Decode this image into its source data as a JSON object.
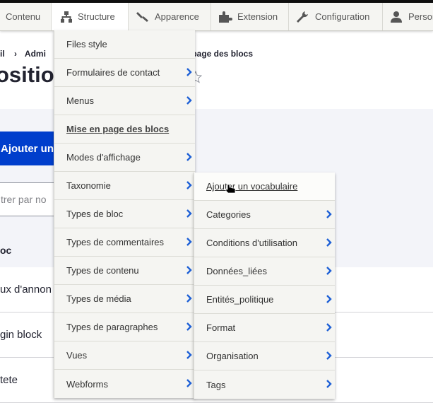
{
  "toolbar": {
    "items": [
      {
        "label": "Contenu",
        "icon": "content-icon"
      },
      {
        "label": "Structure",
        "icon": "structure-icon"
      },
      {
        "label": "Apparence",
        "icon": "paintbrush-icon"
      },
      {
        "label": "Extension",
        "icon": "puzzle-icon"
      },
      {
        "label": "Configuration",
        "icon": "wrench-icon"
      },
      {
        "label": "Person",
        "icon": "person-icon"
      }
    ]
  },
  "breadcrumb": {
    "home": "il",
    "sep": "›",
    "admin": "Admi",
    "current": "en page des blocs"
  },
  "page": {
    "title": "ositio",
    "add_button": "Ajouter un",
    "filter_placeholder": "trer par no",
    "table_header": "oc",
    "rows": [
      "ux d'annon",
      "gin block",
      "tete"
    ]
  },
  "structure_menu": {
    "items": [
      {
        "label": "Files style",
        "has_children": false
      },
      {
        "label": "Formulaires de contact",
        "has_children": true
      },
      {
        "label": "Menus",
        "has_children": true
      },
      {
        "label": "Mise en page des blocs",
        "has_children": false,
        "active": true
      },
      {
        "label": "Modes d'affichage",
        "has_children": true
      },
      {
        "label": "Taxonomie",
        "has_children": true
      },
      {
        "label": "Types de bloc",
        "has_children": true
      },
      {
        "label": "Types de commentaires",
        "has_children": true
      },
      {
        "label": "Types de contenu",
        "has_children": true
      },
      {
        "label": "Types de média",
        "has_children": true
      },
      {
        "label": "Types de paragraphes",
        "has_children": true
      },
      {
        "label": "Vues",
        "has_children": true
      },
      {
        "label": "Webforms",
        "has_children": true
      }
    ]
  },
  "taxonomy_menu": {
    "items": [
      {
        "label": "Ajouter un vocabulaire",
        "has_children": false
      },
      {
        "label": "Categories",
        "has_children": true
      },
      {
        "label": "Conditions d'utilisation",
        "has_children": true
      },
      {
        "label": "Données_liées",
        "has_children": true
      },
      {
        "label": "Entités_politique",
        "has_children": true
      },
      {
        "label": "Format",
        "has_children": true
      },
      {
        "label": "Organisation",
        "has_children": true
      },
      {
        "label": "Tags",
        "has_children": true
      }
    ]
  },
  "colors": {
    "accent": "#003ecc",
    "chevron": "#1e60d6",
    "toolbar_bg": "#f5f5f2"
  }
}
